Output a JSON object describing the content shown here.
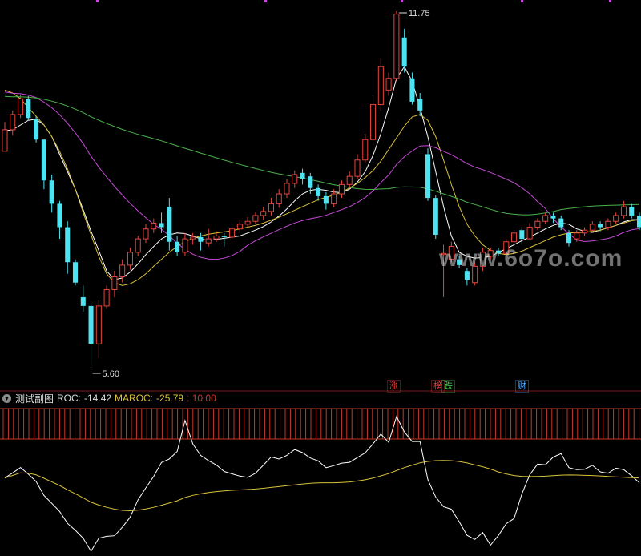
{
  "colors": {
    "up": "#e8453c",
    "down": "#4de3f0",
    "ma_white": "#ffffff",
    "ma_yellow": "#d9c23a",
    "ma_magenta": "#c64ad8",
    "ma_green": "#4bb24b",
    "maroc": "#d9c23a",
    "roc": "#ffffff",
    "vol_bar": "#c8362c",
    "tag_zhang": "#e8453c",
    "tag_bang": "#e8453c",
    "tag_die": "#4bd84b",
    "tag_cai": "#4da6ff"
  },
  "header": {
    "collapse_icon": "chevron-down-icon",
    "indicator_name": "测试副图",
    "roc_label": "ROC:",
    "roc_value": "-14.42",
    "maroc_label": "MAROC:",
    "maroc_value": "-25.79",
    "extra_value": ": 10.00"
  },
  "event_tags": {
    "zhang": "涨",
    "bang": "榜",
    "die": "跌",
    "cai": "财"
  },
  "watermark": "www.6o7o.com",
  "chart_data": [
    {
      "type": "candlestick",
      "title": "",
      "annotations": [
        {
          "text": "11.75",
          "marks": "max high"
        },
        {
          "text": "5.60",
          "marks": "min low"
        }
      ],
      "ylim": [
        5.4,
        11.8
      ],
      "candles": [
        [
          9.35,
          9.72,
          9.35,
          9.85
        ],
        [
          9.72,
          9.98,
          9.62,
          10.05
        ],
        [
          9.98,
          10.25,
          9.92,
          10.32
        ],
        [
          10.25,
          9.92,
          9.88,
          10.3
        ],
        [
          9.9,
          9.55,
          9.5,
          9.95
        ],
        [
          9.55,
          8.85,
          8.7,
          9.55
        ],
        [
          8.85,
          8.45,
          8.3,
          8.95
        ],
        [
          8.45,
          8.05,
          7.85,
          8.5
        ],
        [
          8.05,
          7.45,
          7.25,
          8.15
        ],
        [
          7.45,
          7.1,
          7.05,
          7.5
        ],
        [
          6.85,
          6.7,
          6.6,
          7.05
        ],
        [
          6.7,
          6.05,
          5.6,
          6.75
        ],
        [
          6.05,
          6.7,
          5.8,
          6.8
        ],
        [
          6.7,
          6.98,
          6.65,
          7.05
        ],
        [
          6.98,
          7.2,
          6.85,
          7.3
        ],
        [
          7.2,
          7.4,
          7.1,
          7.5
        ],
        [
          7.4,
          7.62,
          7.32,
          7.7
        ],
        [
          7.62,
          7.85,
          7.55,
          7.9
        ],
        [
          7.85,
          8.02,
          7.78,
          8.1
        ],
        [
          8.02,
          8.12,
          7.95,
          8.2
        ],
        [
          8.12,
          8.05,
          7.95,
          8.3
        ],
        [
          8.4,
          7.8,
          7.65,
          8.55
        ],
        [
          7.8,
          7.62,
          7.55,
          7.9
        ],
        [
          7.62,
          7.85,
          7.55,
          7.95
        ],
        [
          7.85,
          7.88,
          7.75,
          7.95
        ],
        [
          7.88,
          7.8,
          7.65,
          7.95
        ],
        [
          7.78,
          7.85,
          7.72,
          8.02
        ],
        [
          7.85,
          7.9,
          7.8,
          7.98
        ],
        [
          7.9,
          7.88,
          7.72,
          7.95
        ],
        [
          7.88,
          8.02,
          7.82,
          8.1
        ],
        [
          8.02,
          8.1,
          7.95,
          8.18
        ],
        [
          8.1,
          8.15,
          8.05,
          8.22
        ],
        [
          8.15,
          8.25,
          8.1,
          8.3
        ],
        [
          8.25,
          8.32,
          8.18,
          8.4
        ],
        [
          8.32,
          8.45,
          8.25,
          8.55
        ],
        [
          8.45,
          8.62,
          8.38,
          8.7
        ],
        [
          8.62,
          8.8,
          8.55,
          8.88
        ],
        [
          8.8,
          8.95,
          8.72,
          9.02
        ],
        [
          8.98,
          8.88,
          8.78,
          9.05
        ],
        [
          8.92,
          8.72,
          8.62,
          8.98
        ],
        [
          8.72,
          8.58,
          8.5,
          8.78
        ],
        [
          8.58,
          8.45,
          8.35,
          8.65
        ],
        [
          8.45,
          8.62,
          8.4,
          8.7
        ],
        [
          8.62,
          8.78,
          8.55,
          8.85
        ],
        [
          8.78,
          8.92,
          8.72,
          9.0
        ],
        [
          8.92,
          9.2,
          8.88,
          9.3
        ],
        [
          9.2,
          9.55,
          9.15,
          9.65
        ],
        [
          9.55,
          10.15,
          9.45,
          10.3
        ],
        [
          10.15,
          10.8,
          10.05,
          10.95
        ],
        [
          10.4,
          10.6,
          10.3,
          10.7
        ],
        [
          10.6,
          11.7,
          10.55,
          11.75
        ],
        [
          11.3,
          10.8,
          10.7,
          11.45
        ],
        [
          10.6,
          10.2,
          10.15,
          10.7
        ],
        [
          10.25,
          10.05,
          9.95,
          10.35
        ],
        [
          9.3,
          8.55,
          8.5,
          9.4
        ],
        [
          8.55,
          7.92,
          7.85,
          8.6
        ],
        [
          7.58,
          7.6,
          6.85,
          7.75
        ],
        [
          7.5,
          7.72,
          7.45,
          7.8
        ],
        [
          7.5,
          7.4,
          7.35,
          7.55
        ],
        [
          7.3,
          7.15,
          7.05,
          7.35
        ],
        [
          7.1,
          7.38,
          7.05,
          7.45
        ],
        [
          7.38,
          7.62,
          7.3,
          7.7
        ],
        [
          7.55,
          7.65,
          7.5,
          7.7
        ],
        [
          7.65,
          7.6,
          7.55,
          7.7
        ],
        [
          7.6,
          7.8,
          7.55,
          7.85
        ],
        [
          7.8,
          7.95,
          7.75,
          8.0
        ],
        [
          8.0,
          7.85,
          7.75,
          8.05
        ],
        [
          7.85,
          8.05,
          7.82,
          8.12
        ],
        [
          8.05,
          8.15,
          8.0,
          8.2
        ],
        [
          8.15,
          8.25,
          8.1,
          8.3
        ],
        [
          8.25,
          8.2,
          8.12,
          8.3
        ],
        [
          8.2,
          8.05,
          8.0,
          8.25
        ],
        [
          7.95,
          7.78,
          7.72,
          8.0
        ],
        [
          7.85,
          7.95,
          7.8,
          8.0
        ],
        [
          7.95,
          8.0,
          7.9,
          8.05
        ],
        [
          8.0,
          8.1,
          7.95,
          8.15
        ],
        [
          8.1,
          8.05,
          7.98,
          8.15
        ],
        [
          8.05,
          8.15,
          8.0,
          8.2
        ],
        [
          8.15,
          8.25,
          8.1,
          8.3
        ],
        [
          8.25,
          8.4,
          8.2,
          8.5
        ],
        [
          8.4,
          8.25,
          8.2,
          8.45
        ],
        [
          8.25,
          8.05,
          8.0,
          8.3
        ]
      ],
      "moving_averages": {
        "ma_white": [
          9.7,
          9.72,
          9.8,
          9.88,
          9.9,
          9.8,
          9.6,
          9.3,
          9.0,
          8.7,
          8.35,
          7.98,
          7.65,
          7.3,
          7.15,
          7.18,
          7.28,
          7.42,
          7.58,
          7.72,
          7.85,
          7.92,
          7.95,
          7.94,
          7.9,
          7.85,
          7.82,
          7.84,
          7.86,
          7.88,
          7.9,
          7.95,
          8.0,
          8.06,
          8.14,
          8.24,
          8.36,
          8.5,
          8.62,
          8.68,
          8.7,
          8.68,
          8.65,
          8.64,
          8.7,
          8.82,
          9.0,
          9.28,
          9.65,
          10.1,
          10.6,
          10.8,
          10.55,
          10.1,
          9.6,
          9.0,
          8.4,
          7.9,
          7.62,
          7.55,
          7.52,
          7.53,
          7.55,
          7.62,
          7.68,
          7.75,
          7.82,
          7.88,
          7.95,
          8.02,
          8.08,
          8.12,
          8.1,
          8.02,
          7.98,
          7.96,
          8.0,
          8.04,
          8.08,
          8.14,
          8.18,
          8.18
        ],
        "ma_yellow": [
          10.4,
          10.35,
          10.25,
          10.1,
          9.95,
          9.8,
          9.6,
          9.35,
          9.05,
          8.7,
          8.3,
          7.92,
          7.55,
          7.25,
          7.1,
          7.05,
          7.08,
          7.15,
          7.25,
          7.38,
          7.5,
          7.62,
          7.72,
          7.8,
          7.86,
          7.9,
          7.93,
          7.95,
          7.97,
          7.99,
          8.02,
          8.05,
          8.08,
          8.12,
          8.17,
          8.22,
          8.28,
          8.34,
          8.4,
          8.46,
          8.52,
          8.56,
          8.6,
          8.65,
          8.72,
          8.8,
          8.9,
          9.02,
          9.18,
          9.38,
          9.58,
          9.78,
          9.94,
          9.98,
          9.88,
          9.6,
          9.2,
          8.78,
          8.4,
          8.1,
          7.9,
          7.75,
          7.65,
          7.6,
          7.58,
          7.6,
          7.64,
          7.7,
          7.76,
          7.82,
          7.88,
          7.92,
          7.95,
          7.96,
          7.96,
          7.98,
          8.0,
          8.04,
          8.08,
          8.12,
          8.16,
          8.18
        ]
      }
    },
    {
      "type": "line",
      "title": "测试副图",
      "series": [
        {
          "name": "ROC",
          "last": -14.42
        },
        {
          "name": "MAROC",
          "last": -25.79
        }
      ]
    }
  ]
}
